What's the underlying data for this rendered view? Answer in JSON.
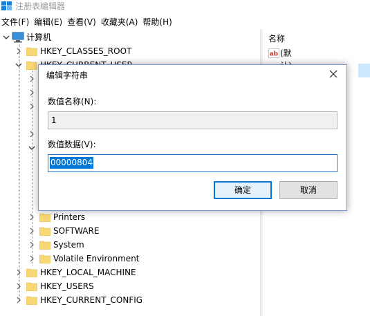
{
  "window": {
    "title": "注册表编辑器"
  },
  "menu": [
    {
      "label": "文件(F)"
    },
    {
      "label": "编辑(E)"
    },
    {
      "label": "查看(V)"
    },
    {
      "label": "收藏夹(A)"
    },
    {
      "label": "帮助(H)"
    }
  ],
  "tree": {
    "root": "计算机",
    "hives": [
      {
        "label": "HKEY_CLASSES_ROOT"
      },
      {
        "label": "HKEY_CURRENT_USER"
      },
      {
        "label": "HKEY_LOCAL_MACHINE"
      },
      {
        "label": "HKEY_USERS"
      },
      {
        "label": "HKEY_CURRENT_CONFIG"
      }
    ],
    "current_user_children": [
      {
        "label": "Printers"
      },
      {
        "label": "SOFTWARE"
      },
      {
        "label": "System"
      },
      {
        "label": "Volatile Environment"
      }
    ]
  },
  "values_pane": {
    "header_name": "名称",
    "rows": [
      {
        "name": "(默认)",
        "icon": "ab-string-icon"
      }
    ]
  },
  "dialog": {
    "title": "编辑字符串",
    "name_label": "数值名称(N):",
    "name_value": "1",
    "data_label": "数值数据(V):",
    "data_value": "00000804",
    "ok_label": "确定",
    "cancel_label": "取消"
  },
  "colors": {
    "accent": "#0078d7",
    "folder": "#f8d775",
    "selection": "#cce8ff"
  }
}
